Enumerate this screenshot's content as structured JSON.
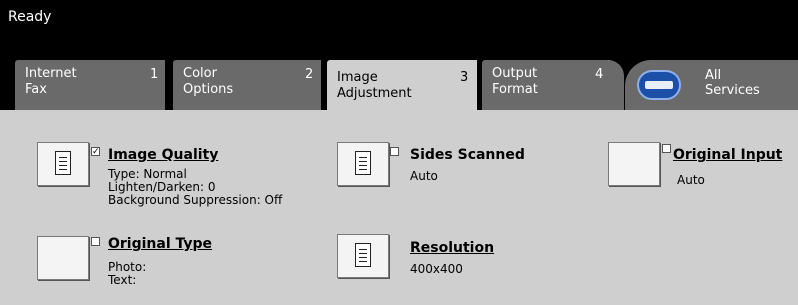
{
  "status": {
    "text": "Ready"
  },
  "tabs": [
    {
      "label": "Internet\nFax",
      "num": "1"
    },
    {
      "label": "Color\nOptions",
      "num": "2"
    },
    {
      "label": "Image\nAdjustment",
      "num": "3"
    },
    {
      "label": "Output\nFormat",
      "num": "4"
    }
  ],
  "services": {
    "label": "All\nServices",
    "icon": "services-icon"
  },
  "features": {
    "image_quality": {
      "title": "Image Quality",
      "checked": true,
      "lines": [
        "Type: Normal",
        "Lighten/Darken: 0",
        "Background Suppression: Off"
      ]
    },
    "sides_scanned": {
      "title": "Sides Scanned",
      "value": "Auto"
    },
    "original_input": {
      "title": "Original Input",
      "value": "Auto"
    },
    "original_type": {
      "title": "Original Type",
      "lines": [
        "Photo:",
        "Text:"
      ]
    },
    "resolution": {
      "title": "Resolution",
      "value": "400x400"
    }
  }
}
